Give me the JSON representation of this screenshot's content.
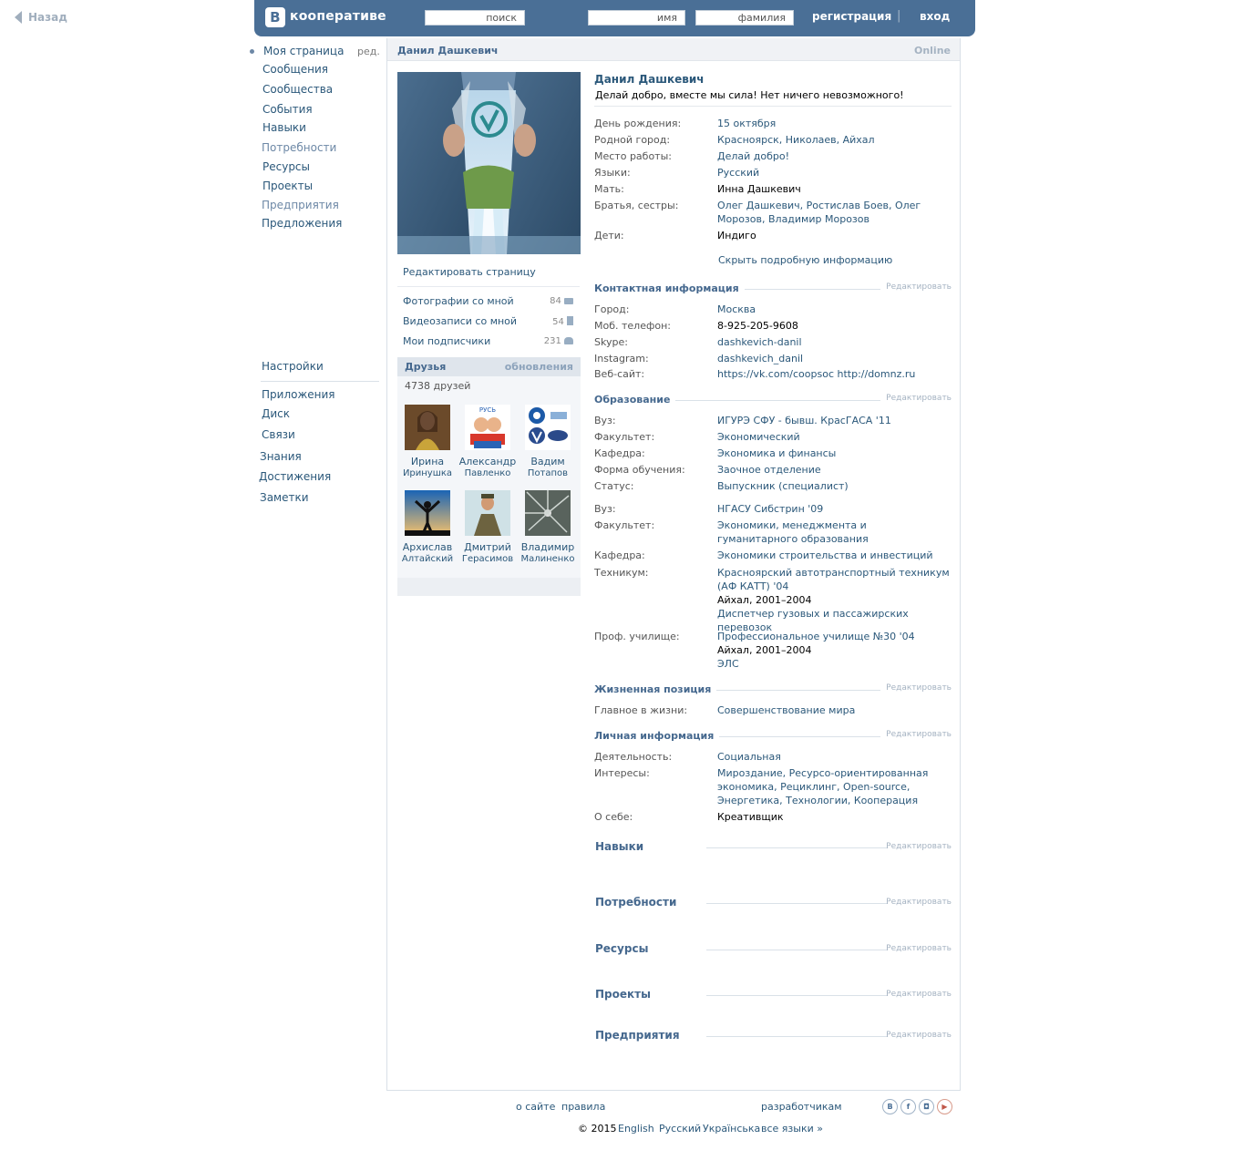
{
  "back": {
    "label": "Назад"
  },
  "header": {
    "logo_letter": "B",
    "logo_text": "кооперативе",
    "search_placeholder": "поиск",
    "first_name_placeholder": "имя",
    "last_name_placeholder": "фамилия",
    "register": "регистрация",
    "separator": "|",
    "login": "вход"
  },
  "nav": {
    "edit": "ред.",
    "items": [
      "Моя страница",
      "Сообщения",
      "Сообщества",
      "События",
      "Навыки",
      "Потребности",
      "Ресурсы",
      "Проекты",
      "Предприятия",
      "Предложения"
    ],
    "settings": "Настройки",
    "items2": [
      "Приложения",
      "Диск",
      "Связи",
      "Знания",
      "Достижения",
      "Заметки"
    ]
  },
  "profile": {
    "title": "Данил Дашкевич",
    "online": "Online",
    "name": "Данил Дашкевич",
    "status": "Делай добро, вместе мы сила! Нет ничего невозможного!",
    "edit_page": "Редактировать страницу",
    "media": [
      {
        "label": "Фотографии со мной",
        "count": "84"
      },
      {
        "label": "Видеозаписи со мной",
        "count": "54"
      },
      {
        "label": "Мои подписчики",
        "count": "231"
      }
    ]
  },
  "friends": {
    "title": "Друзья",
    "updates": "обновления",
    "count": "4738 друзей",
    "list": [
      {
        "first": "Ирина",
        "last": "Иринушка"
      },
      {
        "first": "Александр",
        "last": "Павленко"
      },
      {
        "first": "Вадим",
        "last": "Потапов"
      },
      {
        "first": "Архислав",
        "last": "Алтайский"
      },
      {
        "first": "Дмитрий",
        "last": "Герасимов"
      },
      {
        "first": "Владимир",
        "last": "Малиненко"
      }
    ]
  },
  "info": {
    "basic": [
      {
        "k": "День рождения:",
        "v": "15 октября"
      },
      {
        "k": "Родной город:",
        "v": "Красноярск, Николаев, Айхал"
      },
      {
        "k": "Место работы:",
        "v": "Делай добро!"
      },
      {
        "k": "Языки:",
        "v": "Русский"
      },
      {
        "k": "Мать:",
        "v": "Инна Дашкевич"
      },
      {
        "k": "Братья, сестры:",
        "v": "Олег Дашкевич, Ростислав Боев, Олег Морозов, Владимир Морозов"
      },
      {
        "k": "Дети:",
        "v": "Индиго"
      }
    ],
    "show_more": "Скрыть подробную информацию",
    "edit_label": "Редактировать",
    "contact_title": "Контактная информация",
    "contact": [
      {
        "k": "Город:",
        "v": "Москва"
      },
      {
        "k": "Моб. телефон:",
        "v": "8-925-205-9608"
      },
      {
        "k": "Skype:",
        "v": "dashkevich-danil"
      },
      {
        "k": "Instagram:",
        "v": "dashkevich_danil"
      },
      {
        "k": "Веб-сайт:",
        "v": "https://vk.com/coopsoc http://domnz.ru"
      }
    ],
    "education_title": "Образование",
    "education": [
      {
        "k": "Вуз:",
        "v": "ИГУРЭ СФУ - бывш. КрасГАСА '11"
      },
      {
        "k": "Факультет:",
        "v": "Экономический"
      },
      {
        "k": "Кафедра:",
        "v": "Экономика и финансы"
      },
      {
        "k": "Форма обучения:",
        "v": "Заочное отделение"
      },
      {
        "k": "Статус:",
        "v": "Выпускник (специалист)"
      },
      {
        "k": "Вуз:",
        "v": "НГАСУ Сибстрин '09"
      },
      {
        "k": "Факультет:",
        "v": "Экономики, менеджмента и гуманитарного образования"
      },
      {
        "k": "Кафедра:",
        "v": "Экономики строительства и инвестиций"
      },
      {
        "k": "Техникум:",
        "v": "Красноярский автотранспортный техникум (АФ КАТТ) '04"
      },
      {
        "k": "",
        "v": "Айхал, 2001–2004"
      },
      {
        "k": "",
        "v": "Диспетчер гузовых и пассажирских перевозок"
      },
      {
        "k": "Проф. училище:",
        "v": "Профессиональное училище №30 '04"
      },
      {
        "k": "",
        "v": "Айхал, 2001–2004"
      },
      {
        "k": "",
        "v": "ЭЛС"
      }
    ],
    "life_title": "Жизненная позиция",
    "life": [
      {
        "k": "Главное в жизни:",
        "v": "Совершенствование мира"
      }
    ],
    "personal_title": "Личная информация",
    "personal": [
      {
        "k": "Деятельность:",
        "v": "Социальная"
      },
      {
        "k": "Интересы:",
        "v": "Мироздание, Ресурсо-ориентированная экономика, Рециклинг, Open-source, Энергетика, Технологии, Кооперация"
      },
      {
        "k": "О себе:",
        "v": "Креативщик"
      }
    ],
    "extra_sections": [
      "Навыки",
      "Потребности",
      "Ресурсы",
      "Проекты",
      "Предприятия"
    ]
  },
  "footer": {
    "about": "о сайте",
    "rules": "правила",
    "developers": "разработчикам",
    "copyright": "© 2015",
    "lang_en": "English",
    "lang_ru": "Русский",
    "lang_ua": "Українська",
    "all_langs": "все языки »",
    "social": [
      "vk-icon",
      "facebook-icon",
      "instagram-icon",
      "youtube-icon"
    ]
  },
  "colors": {
    "header": "#4a6f96",
    "link": "#2b587a",
    "section": "#45688e"
  }
}
